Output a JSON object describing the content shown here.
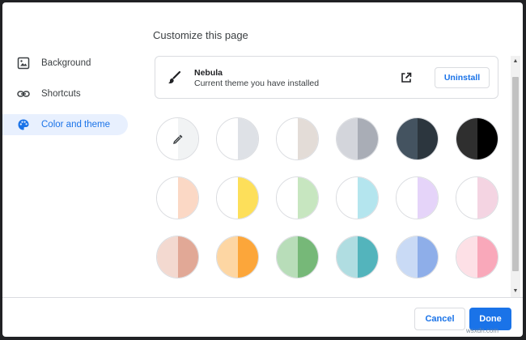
{
  "dialog": {
    "title": "Customize this page"
  },
  "sidebar": {
    "items": [
      {
        "label": "Background",
        "icon": "image-icon",
        "active": false
      },
      {
        "label": "Shortcuts",
        "icon": "link-icon",
        "active": false
      },
      {
        "label": "Color and theme",
        "icon": "palette-icon",
        "active": true
      }
    ]
  },
  "theme": {
    "name": "Nebula",
    "subtitle": "Current theme you have installed",
    "uninstall_label": "Uninstall"
  },
  "colors": {
    "accent": "#1a73e8",
    "swatches": [
      {
        "left": "#ffffff",
        "right": "#f1f3f4",
        "picker": true
      },
      {
        "left": "#ffffff",
        "right": "#dee1e6"
      },
      {
        "left": "#ffffff",
        "right": "#e3dcd7"
      },
      {
        "left": "#d3d5db",
        "right": "#a9adb6"
      },
      {
        "left": "#445360",
        "right": "#2c363e"
      },
      {
        "left": "#2f2f2f",
        "right": "#000000"
      },
      {
        "left": "#ffffff",
        "right": "#fbd8c5"
      },
      {
        "left": "#ffffff",
        "right": "#fddf5a"
      },
      {
        "left": "#ffffff",
        "right": "#c7e6c0"
      },
      {
        "left": "#ffffff",
        "right": "#b4e5ee"
      },
      {
        "left": "#ffffff",
        "right": "#e5d4f9"
      },
      {
        "left": "#ffffff",
        "right": "#f4d4e2"
      },
      {
        "left": "#f3d9d0",
        "right": "#e1a896"
      },
      {
        "left": "#fdd6a3",
        "right": "#fca63a"
      },
      {
        "left": "#b8ddb9",
        "right": "#76b878"
      },
      {
        "left": "#b0dde1",
        "right": "#53b4bc"
      },
      {
        "left": "#c9daf5",
        "right": "#8eaee9"
      },
      {
        "left": "#fde0e6",
        "right": "#f9a8ba"
      }
    ]
  },
  "footer": {
    "cancel_label": "Cancel",
    "done_label": "Done"
  },
  "watermark": "wsxdn.com"
}
